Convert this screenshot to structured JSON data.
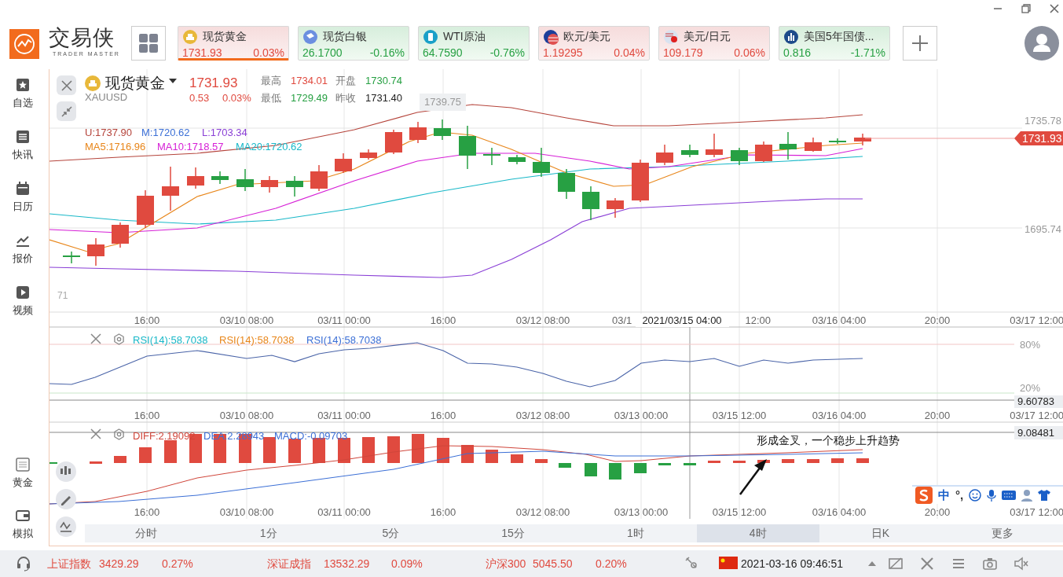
{
  "app": {
    "logo_text": "交易侠",
    "logo_subtitle": "TRADER MASTER"
  },
  "quotes": [
    {
      "name": "现货黄金",
      "price": "1731.93",
      "change": "0.03%",
      "color": "#e04a3f",
      "selected": true,
      "kind": "gold"
    },
    {
      "name": "现货白银",
      "price": "26.1700",
      "change": "-0.16%",
      "color": "#27a043",
      "selected": false,
      "kind": "silver"
    },
    {
      "name": "WTI原油",
      "price": "64.7590",
      "change": "-0.76%",
      "color": "#27a043",
      "selected": false,
      "kind": "oil"
    },
    {
      "name": "欧元/美元",
      "price": "1.19295",
      "change": "0.04%",
      "color": "#e04a3f",
      "selected": false,
      "kind": "eur"
    },
    {
      "name": "美元/日元",
      "price": "109.179",
      "change": "0.06%",
      "color": "#e04a3f",
      "selected": false,
      "kind": "jpy"
    },
    {
      "name": "美国5年国债...",
      "price": "0.816",
      "change": "-1.71%",
      "color": "#27a043",
      "selected": false,
      "kind": "bond"
    }
  ],
  "sidebar": {
    "items": [
      {
        "label": "自选",
        "kind": "star"
      },
      {
        "label": "快讯",
        "kind": "list"
      },
      {
        "label": "日历",
        "kind": "calendar"
      },
      {
        "label": "报价",
        "kind": "chart"
      },
      {
        "label": "视频",
        "kind": "play"
      }
    ],
    "bottom_items": [
      {
        "label": "黄金",
        "kind": "gold"
      },
      {
        "label": "模拟",
        "kind": "wallet"
      }
    ]
  },
  "instrument": {
    "name": "现货黄金",
    "symbol": "XAUUSD",
    "price": "1731.93",
    "change": "0.53",
    "change_pct": "0.03%",
    "stats": [
      {
        "label": "最高",
        "value": "1734.01",
        "color": "#e04a3f"
      },
      {
        "label": "开盘",
        "value": "1730.74",
        "color": "#27a043"
      },
      {
        "label": "最低",
        "value": "1729.49",
        "color": "#27a043"
      },
      {
        "label": "昨收",
        "value": "1731.40",
        "color": "#222222"
      }
    ]
  },
  "price_chart": {
    "peak_label": "1739.75",
    "boll": [
      {
        "text": "U:1737.90",
        "color": "#b5443b"
      },
      {
        "text": "M:1720.62",
        "color": "#3b6fd6"
      },
      {
        "text": "L:1703.34",
        "color": "#8a3fd6"
      }
    ],
    "ma": [
      {
        "text": "MA5:1716.96",
        "color": "#e8861a"
      },
      {
        "text": "MA10:1718.57",
        "color": "#d61fd6"
      },
      {
        "text": "MA20:1720.62",
        "color": "#19b8c8"
      }
    ],
    "y_labels": [
      "1735.78",
      "1695.74"
    ],
    "current_price": "1731.93",
    "corner_label": "71",
    "crosshair_label": "2021/03/15 04:00",
    "x_labels": [
      "16:00",
      "03/10 08:00",
      "03/11 00:00",
      "16:00",
      "03/12 08:00",
      "03/1",
      "12:00",
      "03/16 04:00",
      "20:00",
      "03/17 12:00"
    ]
  },
  "rsi_panel": {
    "legend": [
      {
        "text": "RSI(14):58.7038",
        "color": "#19b8c8"
      },
      {
        "text": "RSI(14):58.7038",
        "color": "#e8861a"
      },
      {
        "text": "RSI(14):58.7038",
        "color": "#3b6fd6"
      }
    ],
    "y_labels": [
      "80%",
      "20%"
    ],
    "value_label": "9.60783",
    "x_labels": [
      "16:00",
      "03/10 08:00",
      "03/11 00:00",
      "16:00",
      "03/12 08:00",
      "03/13 00:00",
      "03/15 12:00",
      "03/16 04:00",
      "20:00",
      "03/17 12:00"
    ]
  },
  "macd_panel": {
    "legend": [
      {
        "text": "DIFF:2.19092",
        "color": "#d0463b"
      },
      {
        "text": "DEA:2.28943",
        "color": "#3b6fd6"
      },
      {
        "text": "MACD:-0.09703",
        "color": "#3b6fd6"
      }
    ],
    "value_label": "9.08481",
    "annotation": "形成金叉，一个稳步上升趋势",
    "x_labels": [
      "16:00",
      "03/10 08:00",
      "03/11 00:00",
      "16:00",
      "03/12 08:00",
      "03/13 00:00",
      "03/15 12:00",
      "03/16 04:00",
      "20:00",
      "03/17 12:00"
    ]
  },
  "timeframes": [
    {
      "label": "分时",
      "selected": false
    },
    {
      "label": "1分",
      "selected": false
    },
    {
      "label": "5分",
      "selected": false
    },
    {
      "label": "15分",
      "selected": false
    },
    {
      "label": "1时",
      "selected": false
    },
    {
      "label": "4时",
      "selected": true
    },
    {
      "label": "日K",
      "selected": false
    },
    {
      "label": "更多",
      "selected": false
    }
  ],
  "ime_toolbar": {
    "items": [
      "中",
      "°,"
    ]
  },
  "status_bar": {
    "indices": [
      {
        "name": "上证指数",
        "value": "3429.29",
        "change": "0.27%",
        "color": "#e04a3f"
      },
      {
        "name": "深证成指",
        "value": "13532.29",
        "change": "0.09%",
        "color": "#e04a3f"
      },
      {
        "name": "沪深300",
        "value": "5045.50",
        "change": "0.20%",
        "color": "#e04a3f"
      }
    ],
    "datetime": "2021-03-16 09:46:51"
  }
}
